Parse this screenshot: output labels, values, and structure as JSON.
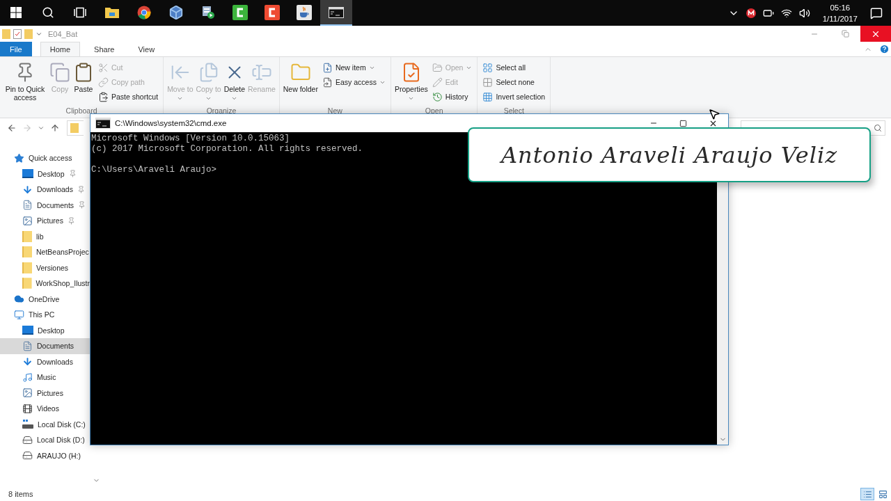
{
  "taskbar": {
    "apps": [
      {
        "kind": "start",
        "selected": false
      },
      {
        "kind": "search",
        "selected": false
      },
      {
        "kind": "taskview",
        "selected": false
      },
      {
        "kind": "explorer",
        "selected": false
      },
      {
        "kind": "chrome",
        "selected": false
      },
      {
        "kind": "cube",
        "selected": false
      },
      {
        "kind": "player",
        "selected": false
      },
      {
        "kind": "green-c",
        "selected": false
      },
      {
        "kind": "red-c",
        "selected": false
      },
      {
        "kind": "java",
        "selected": false
      },
      {
        "kind": "cmd",
        "selected": true
      }
    ],
    "tray": {
      "time": "05:16",
      "date": "1/11/2017"
    }
  },
  "explorer": {
    "title": "E04_Bat",
    "tabs": [
      {
        "label": "File",
        "kind": "file",
        "selected": false
      },
      {
        "label": "Home",
        "kind": "tab",
        "selected": true
      },
      {
        "label": "Share",
        "kind": "tab",
        "selected": false
      },
      {
        "label": "View",
        "kind": "tab",
        "selected": false
      }
    ],
    "ribbon": [
      {
        "label": "Clipboard",
        "items": [
          {
            "label": "Pin to Quick access",
            "kind": "large",
            "disabled": false,
            "dropdown": false
          },
          {
            "label": "Copy",
            "kind": "large",
            "disabled": true,
            "dropdown": false
          },
          {
            "label": "Paste",
            "kind": "large",
            "disabled": false,
            "dropdown": false
          },
          {
            "label": "Cut",
            "kind": "small",
            "disabled": true,
            "dropdown": false
          },
          {
            "label": "Copy path",
            "kind": "small",
            "disabled": true,
            "dropdown": false
          },
          {
            "label": "Paste shortcut",
            "kind": "small",
            "disabled": false,
            "dropdown": false
          }
        ]
      },
      {
        "label": "Organize",
        "items": [
          {
            "label": "Move to",
            "kind": "large",
            "disabled": true,
            "dropdown": true
          },
          {
            "label": "Copy to",
            "kind": "large",
            "disabled": true,
            "dropdown": true
          },
          {
            "label": "Delete",
            "kind": "large",
            "disabled": false,
            "dropdown": true
          },
          {
            "label": "Rename",
            "kind": "large",
            "disabled": true,
            "dropdown": false
          }
        ]
      },
      {
        "label": "New",
        "items": [
          {
            "label": "New folder",
            "kind": "large",
            "disabled": false,
            "dropdown": false
          },
          {
            "label": "New item",
            "kind": "small",
            "disabled": false,
            "dropdown": true
          },
          {
            "label": "Easy access",
            "kind": "small",
            "disabled": false,
            "dropdown": true
          }
        ]
      },
      {
        "label": "Open",
        "items": [
          {
            "label": "Properties",
            "kind": "large",
            "disabled": false,
            "dropdown": true
          },
          {
            "label": "Open",
            "kind": "small",
            "disabled": true,
            "dropdown": true
          },
          {
            "label": "Edit",
            "kind": "small",
            "disabled": true,
            "dropdown": false
          },
          {
            "label": "History",
            "kind": "small",
            "disabled": false,
            "dropdown": false
          }
        ]
      },
      {
        "label": "Select",
        "items": [
          {
            "label": "Select all",
            "kind": "small",
            "disabled": false,
            "dropdown": false
          },
          {
            "label": "Select none",
            "kind": "small",
            "disabled": false,
            "dropdown": false
          },
          {
            "label": "Invert selection",
            "kind": "small",
            "disabled": false,
            "dropdown": false
          }
        ]
      }
    ],
    "nav": [
      {
        "label": "Quick access",
        "kind": "star",
        "selected": false,
        "children": [
          {
            "label": "Desktop",
            "kind": "desktop",
            "selected": false,
            "pinned": true
          },
          {
            "label": "Downloads",
            "kind": "downloads",
            "selected": false,
            "pinned": true
          },
          {
            "label": "Documents",
            "kind": "documents",
            "selected": false,
            "pinned": true
          },
          {
            "label": "Pictures",
            "kind": "pictures",
            "selected": false,
            "pinned": true
          },
          {
            "label": "lib",
            "kind": "folder",
            "selected": false,
            "pinned": false
          },
          {
            "label": "NetBeansProjec",
            "kind": "folder",
            "selected": false,
            "pinned": false
          },
          {
            "label": "Versiones",
            "kind": "folder",
            "selected": false,
            "pinned": false
          },
          {
            "label": "WorkShop_Ilustr",
            "kind": "folder",
            "selected": false,
            "pinned": false
          }
        ]
      },
      {
        "label": "OneDrive",
        "kind": "cloud",
        "selected": false
      },
      {
        "label": "This PC",
        "kind": "pc",
        "selected": false,
        "children": [
          {
            "label": "Desktop",
            "kind": "desktop",
            "selected": false,
            "pinned": false
          },
          {
            "label": "Documents",
            "kind": "documents",
            "selected": true,
            "pinned": false
          },
          {
            "label": "Downloads",
            "kind": "downloads",
            "selected": false,
            "pinned": false
          },
          {
            "label": "Music",
            "kind": "music",
            "selected": false,
            "pinned": false
          },
          {
            "label": "Pictures",
            "kind": "pictures",
            "selected": false,
            "pinned": false
          },
          {
            "label": "Videos",
            "kind": "videos",
            "selected": false,
            "pinned": false
          },
          {
            "label": "Local Disk (C:)",
            "kind": "system-drive",
            "selected": false,
            "pinned": false
          },
          {
            "label": "Local Disk (D:)",
            "kind": "drive",
            "selected": false,
            "pinned": false
          },
          {
            "label": "ARAUJO (H:)",
            "kind": "drive",
            "selected": false,
            "pinned": false
          }
        ]
      }
    ],
    "status": "8 items",
    "views": [
      {
        "kind": "details",
        "selected": true
      },
      {
        "kind": "large-icons",
        "selected": false
      }
    ]
  },
  "cmd": {
    "title": "C:\\Windows\\system32\\cmd.exe",
    "lines": [
      "Microsoft Windows [Version 10.0.15063]",
      "(c) 2017 Microsoft Corporation. All rights reserved."
    ],
    "prompt": "C:\\Users\\Araveli Araujo>"
  },
  "caption": "Antonio Araveli Araujo Veliz"
}
